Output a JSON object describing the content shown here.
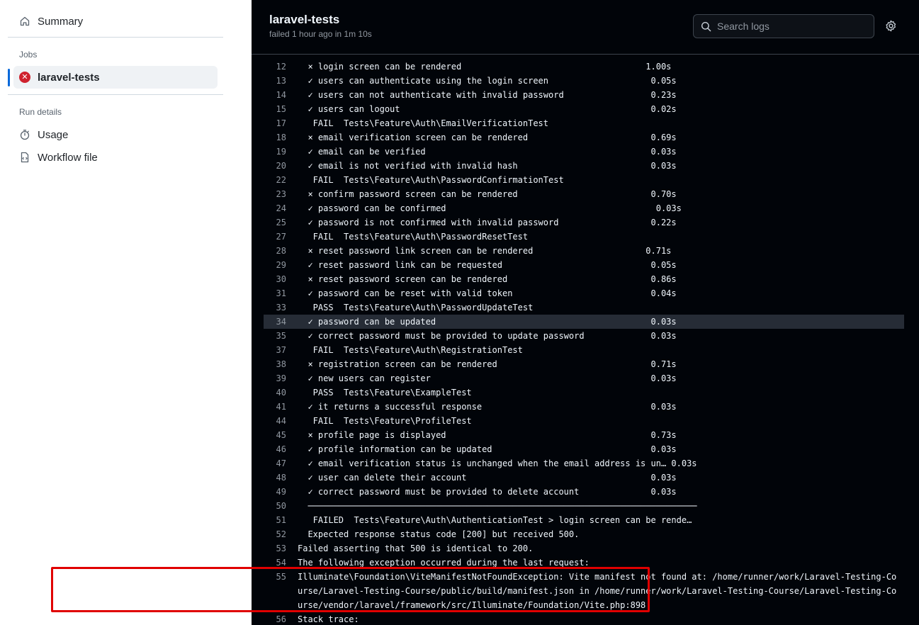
{
  "sidebar": {
    "summary_label": "Summary",
    "jobs_heading": "Jobs",
    "job_label": "laravel-tests",
    "run_details_heading": "Run details",
    "usage_label": "Usage",
    "workflow_label": "Workflow file"
  },
  "header": {
    "title": "laravel-tests",
    "subtitle": "failed 1 hour ago in 1m 10s",
    "search_placeholder": "Search logs"
  },
  "colors": {
    "fail": "#cf222e",
    "accent": "#0969da",
    "panel_bg": "#010409",
    "highlight_box": "#e00000"
  },
  "log": [
    {
      "n": "12",
      "text": "  × login screen can be rendered                                    1.00s"
    },
    {
      "n": "13",
      "text": "  ✓ users can authenticate using the login screen                    0.05s"
    },
    {
      "n": "14",
      "text": "  ✓ users can not authenticate with invalid password                 0.23s"
    },
    {
      "n": "15",
      "text": "  ✓ users can logout                                                 0.02s"
    },
    {
      "n": "17",
      "text": "   FAIL  Tests\\Feature\\Auth\\EmailVerificationTest"
    },
    {
      "n": "18",
      "text": "  × email verification screen can be rendered                        0.69s"
    },
    {
      "n": "19",
      "text": "  ✓ email can be verified                                            0.03s"
    },
    {
      "n": "20",
      "text": "  ✓ email is not verified with invalid hash                          0.03s"
    },
    {
      "n": "22",
      "text": "   FAIL  Tests\\Feature\\Auth\\PasswordConfirmationTest"
    },
    {
      "n": "23",
      "text": "  × confirm password screen can be rendered                          0.70s"
    },
    {
      "n": "24",
      "text": "  ✓ password can be confirmed                                         0.03s"
    },
    {
      "n": "25",
      "text": "  ✓ password is not confirmed with invalid password                  0.22s"
    },
    {
      "n": "27",
      "text": "   FAIL  Tests\\Feature\\Auth\\PasswordResetTest"
    },
    {
      "n": "28",
      "text": "  × reset password link screen can be rendered                      0.71s"
    },
    {
      "n": "29",
      "text": "  ✓ reset password link can be requested                             0.05s"
    },
    {
      "n": "30",
      "text": "  × reset password screen can be rendered                            0.86s"
    },
    {
      "n": "31",
      "text": "  ✓ password can be reset with valid token                           0.04s"
    },
    {
      "n": "33",
      "text": "   PASS  Tests\\Feature\\Auth\\PasswordUpdateTest"
    },
    {
      "n": "34",
      "text": "  ✓ password can be updated                                          0.03s",
      "hl": true
    },
    {
      "n": "35",
      "text": "  ✓ correct password must be provided to update password             0.03s"
    },
    {
      "n": "37",
      "text": "   FAIL  Tests\\Feature\\Auth\\RegistrationTest"
    },
    {
      "n": "38",
      "text": "  × registration screen can be rendered                              0.71s"
    },
    {
      "n": "39",
      "text": "  ✓ new users can register                                           0.03s"
    },
    {
      "n": "40",
      "text": "   PASS  Tests\\Feature\\ExampleTest"
    },
    {
      "n": "41",
      "text": "  ✓ it returns a successful response                                 0.03s"
    },
    {
      "n": "44",
      "text": "   FAIL  Tests\\Feature\\ProfileTest"
    },
    {
      "n": "45",
      "text": "  × profile page is displayed                                        0.73s"
    },
    {
      "n": "46",
      "text": "  ✓ profile information can be updated                               0.03s"
    },
    {
      "n": "47",
      "text": "  ✓ email verification status is unchanged when the email address is un… 0.03s"
    },
    {
      "n": "48",
      "text": "  ✓ user can delete their account                                    0.03s"
    },
    {
      "n": "49",
      "text": "  ✓ correct password must be provided to delete account              0.03s"
    },
    {
      "n": "50",
      "text": "  ────────────────────────────────────────────────────────────────────────────"
    },
    {
      "n": "51",
      "text": "   FAILED  Tests\\Feature\\Auth\\AuthenticationTest > login screen can be rende…"
    },
    {
      "n": "52",
      "text": "  Expected response status code [200] but received 500."
    },
    {
      "n": "53",
      "text": "Failed asserting that 500 is identical to 200."
    },
    {
      "n": "54",
      "text": "The following exception occurred during the last request:"
    },
    {
      "n": "55",
      "text": "Illuminate\\Foundation\\ViteManifestNotFoundException: Vite manifest not found at: /home/runner/work/Laravel-Testing-Course/Laravel-Testing-Course/public/build/manifest.json in /home/runner/work/Laravel-Testing-Course/Laravel-Testing-Course/vendor/laravel/framework/src/Illuminate/Foundation/Vite.php:898",
      "multi": true
    },
    {
      "n": "56",
      "text": "Stack trace:"
    }
  ]
}
